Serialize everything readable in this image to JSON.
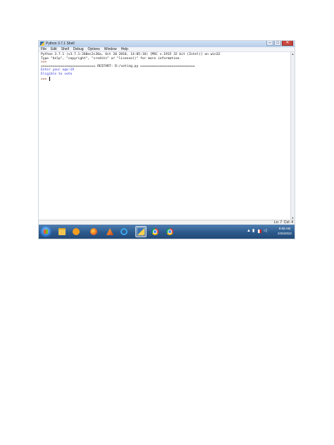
{
  "window": {
    "title": "Python 3.7.1 Shell",
    "controls": {
      "minimize": "–",
      "maximize": "□",
      "close": "✕"
    }
  },
  "menu": [
    "File",
    "Edit",
    "Shell",
    "Debug",
    "Options",
    "Window",
    "Help"
  ],
  "shell": {
    "banner1": "Python 3.7.1 (v3.7.1:260ec2c36a, Oct 20 2018, 14:05:16) [MSC v.1915 32 bit (Intel)] on win32",
    "banner2": "Type \"help\", \"copyright\", \"credits\" or \"license()\" for more information.",
    "prompt1": ">>> ",
    "restart": "============================ RESTART: D:/voting.py ============================",
    "input_line": "Enter your age:19",
    "output_line": "Eligible to vote",
    "prompt2": ">>> "
  },
  "status": {
    "position": "Ln: 7  Col: 4"
  },
  "taskbar": {
    "apps": [
      "start-icon",
      "folder-icon",
      "media-player-icon",
      "firefox-icon",
      "matlab-icon",
      "internet-explorer-icon",
      "python-idle-icon",
      "chrome-icon"
    ],
    "time": "9:58 AM",
    "date": "2/25/2022"
  }
}
